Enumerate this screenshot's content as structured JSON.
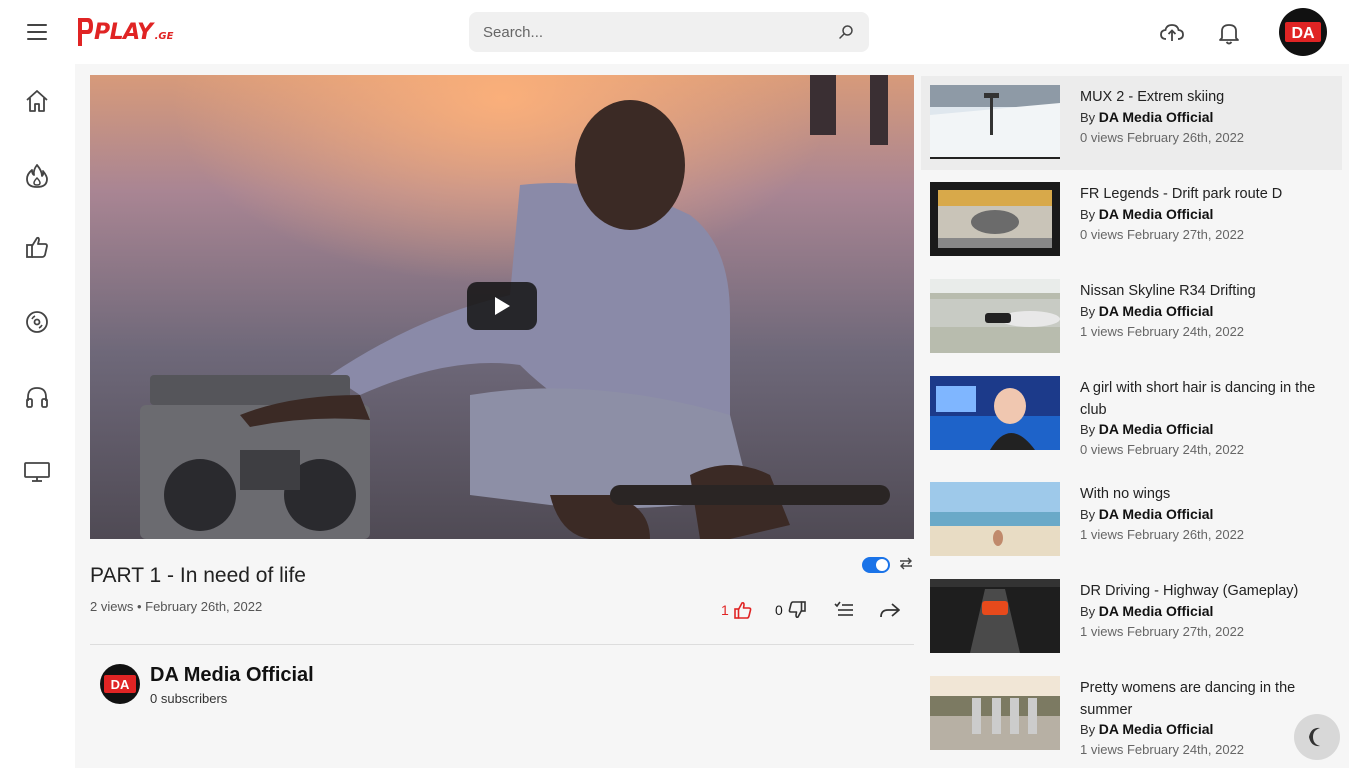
{
  "header": {
    "logo_text": "PLAY",
    "logo_suffix": ".GE",
    "search_placeholder": "Search...",
    "avatar_text": "DA"
  },
  "video": {
    "title": "PART 1 - In need of life",
    "meta": "2 views • February 26th, 2022",
    "likes": "1",
    "dislikes": "0"
  },
  "channel": {
    "avatar_text": "DA",
    "name": "DA Media Official",
    "subscribers": "0 subscribers"
  },
  "related": [
    {
      "title": "MUX 2 - Extrem skiing",
      "by_prefix": "By",
      "author": "DA Media Official",
      "stats": "0 views February 26th, 2022"
    },
    {
      "title": "FR Legends - Drift park route D",
      "by_prefix": "By",
      "author": "DA Media Official",
      "stats": "0 views February 27th, 2022"
    },
    {
      "title": "Nissan Skyline R34 Drifting",
      "by_prefix": "By",
      "author": "DA Media Official",
      "stats": "1 views February 24th, 2022"
    },
    {
      "title": "A girl with short hair is dancing in the club",
      "by_prefix": "By",
      "author": "DA Media Official",
      "stats": "0 views February 24th, 2022"
    },
    {
      "title": "With no wings",
      "by_prefix": "By",
      "author": "DA Media Official",
      "stats": "1 views February 26th, 2022"
    },
    {
      "title": "DR Driving - Highway (Gameplay)",
      "by_prefix": "By",
      "author": "DA Media Official",
      "stats": "1 views February 27th, 2022"
    },
    {
      "title": "Pretty womens are dancing in the summer",
      "by_prefix": "By",
      "author": "DA Media Official",
      "stats": "1 views February 24th, 2022"
    }
  ],
  "colors": {
    "brand": "#e02424",
    "accent": "#1a73e8"
  }
}
